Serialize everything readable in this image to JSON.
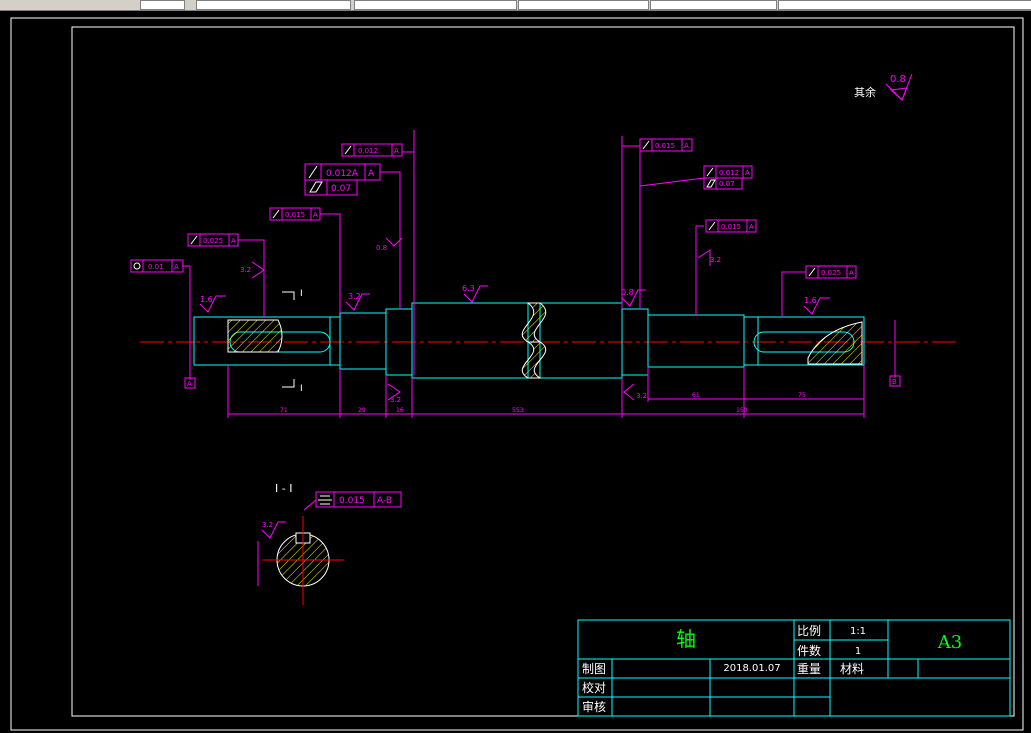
{
  "toolbar": {
    "fields": [
      "",
      "",
      "",
      "",
      "",
      ""
    ]
  },
  "colors": {
    "background": "#000000",
    "frame": "#ffffff",
    "outline": "#00ffff",
    "dimension": "#ff00ff",
    "centerline": "#ff0000",
    "hatch": "#ffff00",
    "title_text": "#00ff00",
    "symbol": "#ffffff"
  },
  "surface_note": {
    "label": "其余",
    "value": "0.8"
  },
  "roughness": [
    "1.6",
    "3.2",
    "3.2",
    "0.8",
    "6.3",
    "0.8",
    "3.2",
    "3.2",
    "1.6",
    "3.2"
  ],
  "tolerance_frames": {
    "f1": {
      "value": "0.01",
      "datum": "A"
    },
    "f2": {
      "value": "0.025",
      "datum": "A"
    },
    "f3": {
      "value": "0.015",
      "datum": "A"
    },
    "f4": {
      "value": "0.012A",
      "datum": "A"
    },
    "f5": {
      "value": "0.07"
    },
    "f6": {
      "value": "0.012",
      "datum": "A"
    },
    "f7": {
      "value": "0.015",
      "datum": "A"
    },
    "f8": {
      "value": "0.012",
      "datum": "A"
    },
    "f9": {
      "value": "0.07"
    },
    "f10": {
      "value": "0.015",
      "datum": "A"
    },
    "f11": {
      "value": "0.025",
      "datum": "A"
    },
    "f12": {
      "value": "0.015",
      "datum": "A-B"
    }
  },
  "datums": {
    "left": "A",
    "right": "B"
  },
  "section_marks": {
    "top": "I",
    "bottom": "I"
  },
  "section_title": "I - I",
  "dimensions": {
    "d1": "71",
    "d2": "29",
    "d3": "16",
    "d4": "553",
    "d5": "61",
    "d6": "150",
    "d7": "75"
  },
  "title_block": {
    "part_name": "轴",
    "scale_label": "比例",
    "scale_value": "1:1",
    "qty_label": "件数",
    "qty_value": "1",
    "sheet_size": "A3",
    "drawn_label": "制图",
    "date": "2018.01.07",
    "weight_label": "重量",
    "material_label": "材料",
    "checked_label": "校对",
    "approved_label": "审核"
  }
}
